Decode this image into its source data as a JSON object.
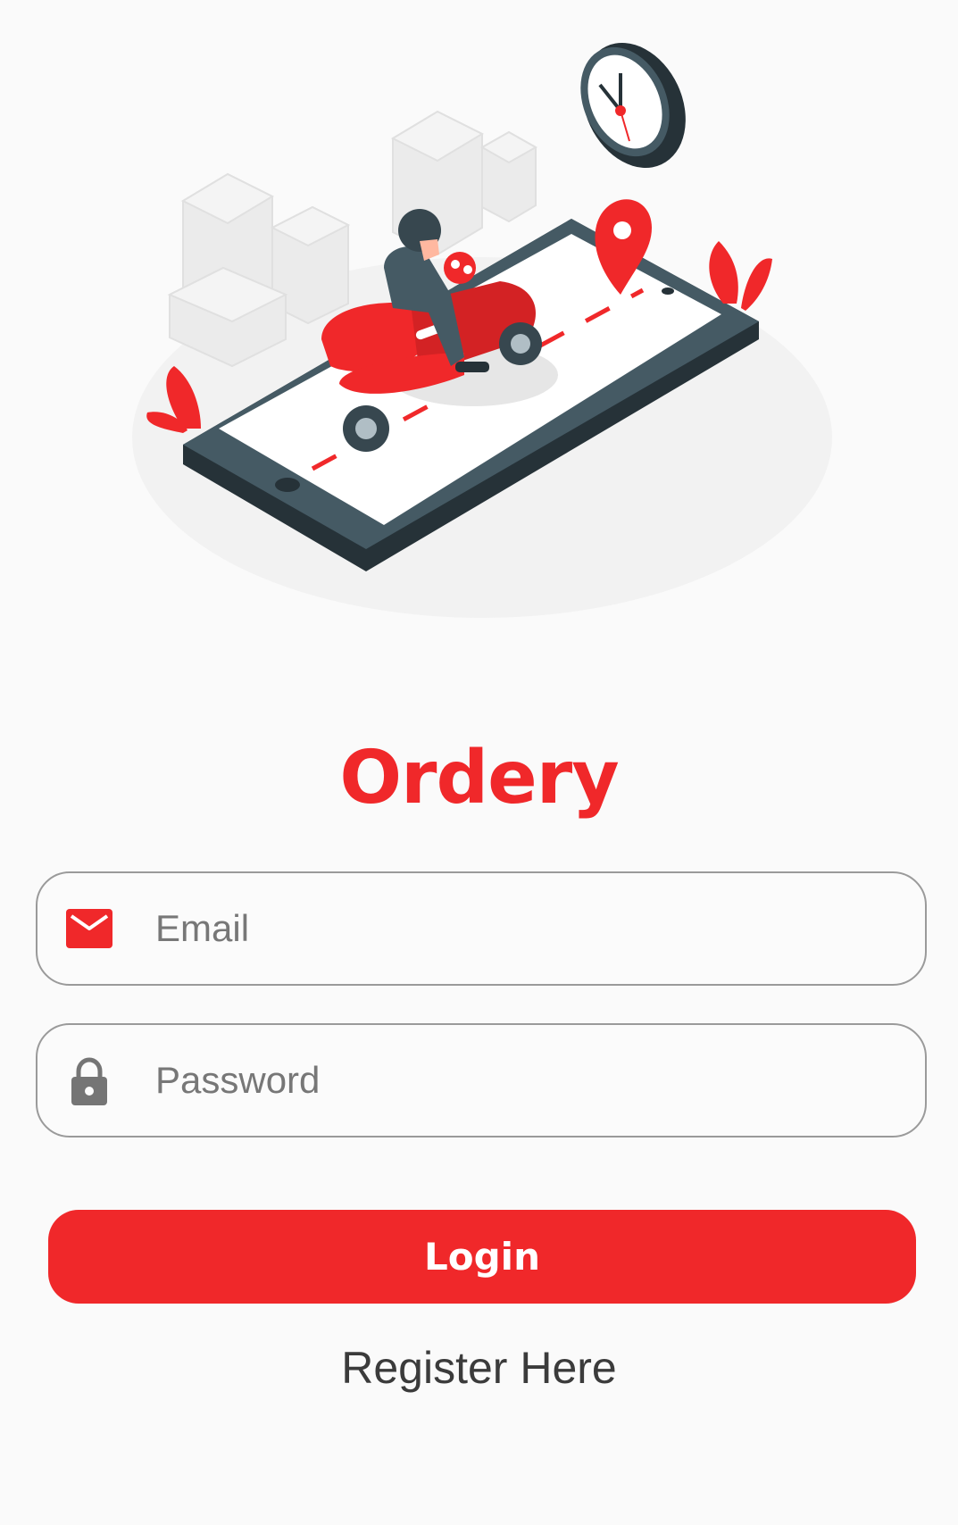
{
  "app": {
    "title": "Ordery"
  },
  "form": {
    "email": {
      "placeholder": "Email",
      "value": "",
      "icon": "mail-icon"
    },
    "password": {
      "placeholder": "Password",
      "value": "",
      "icon": "lock-icon"
    },
    "login_label": "Login",
    "register_label": "Register Here"
  },
  "hero": {
    "illustration": "delivery-scooter-on-phone-illustration"
  },
  "colors": {
    "accent": "#f0282a",
    "background": "#fafafa",
    "border": "#9a9a9a",
    "dark": "#37474f"
  }
}
